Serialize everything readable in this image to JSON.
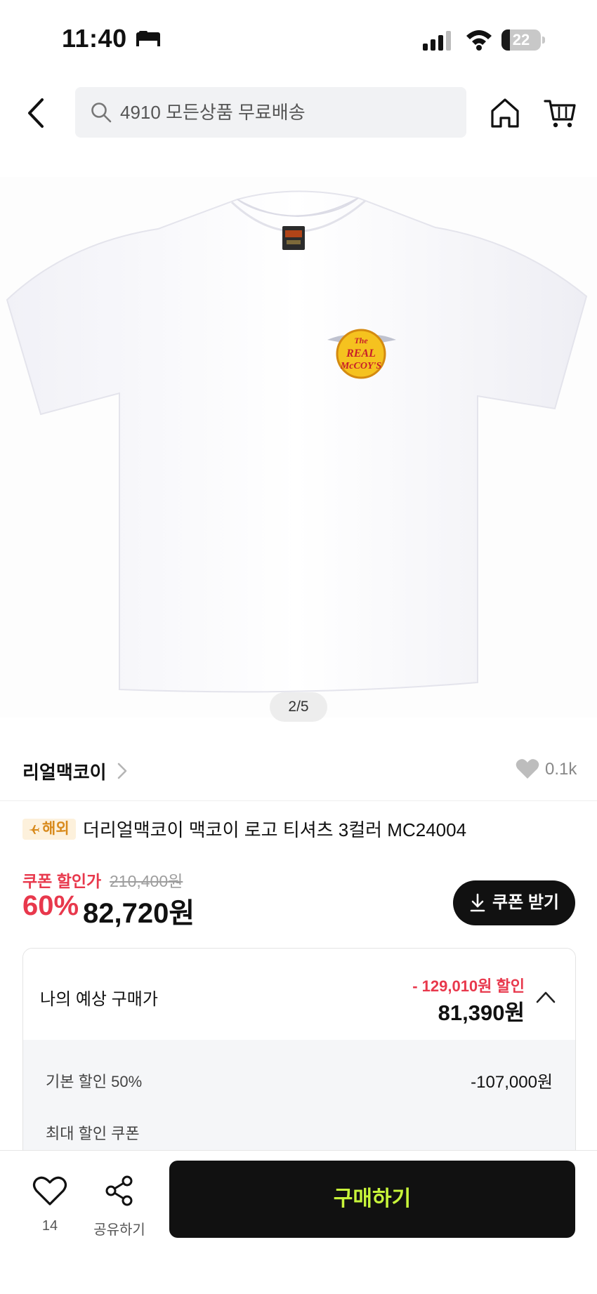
{
  "status_bar": {
    "time": "11:40",
    "battery": "22",
    "battery_level": 0.22
  },
  "search": {
    "placeholder": "4910 모든상품 무료배송"
  },
  "image": {
    "pager": "2/5",
    "logo_lines": [
      "The",
      "REAL",
      "McCOY'S"
    ]
  },
  "brand": {
    "name": "리얼맥코이",
    "like_count": "0.1k"
  },
  "product": {
    "badge": "해외",
    "title": "더리얼맥코이 맥코이 로고 티셔츠 3컬러 MC24004"
  },
  "price": {
    "coupon_label": "쿠폰 할인가",
    "original": "210,400원",
    "discount": "60%",
    "final": "82,720원",
    "coupon_button": "쿠폰 받기"
  },
  "expected": {
    "label": "나의 예상 구매가",
    "saving": "- 129,010원 할인",
    "total": "81,390원",
    "rows": [
      {
        "label": "기본 할인 50%",
        "value": "-107,000원"
      },
      {
        "label": "최대 할인 쿠폰",
        "value": ""
      }
    ]
  },
  "bottom": {
    "like_count": "14",
    "share_label": "공유하기",
    "buy_label": "구매하기"
  },
  "colors": {
    "accent_red": "#e8384c",
    "buy_text": "#c8f53a",
    "badge_text": "#d88a1c"
  }
}
